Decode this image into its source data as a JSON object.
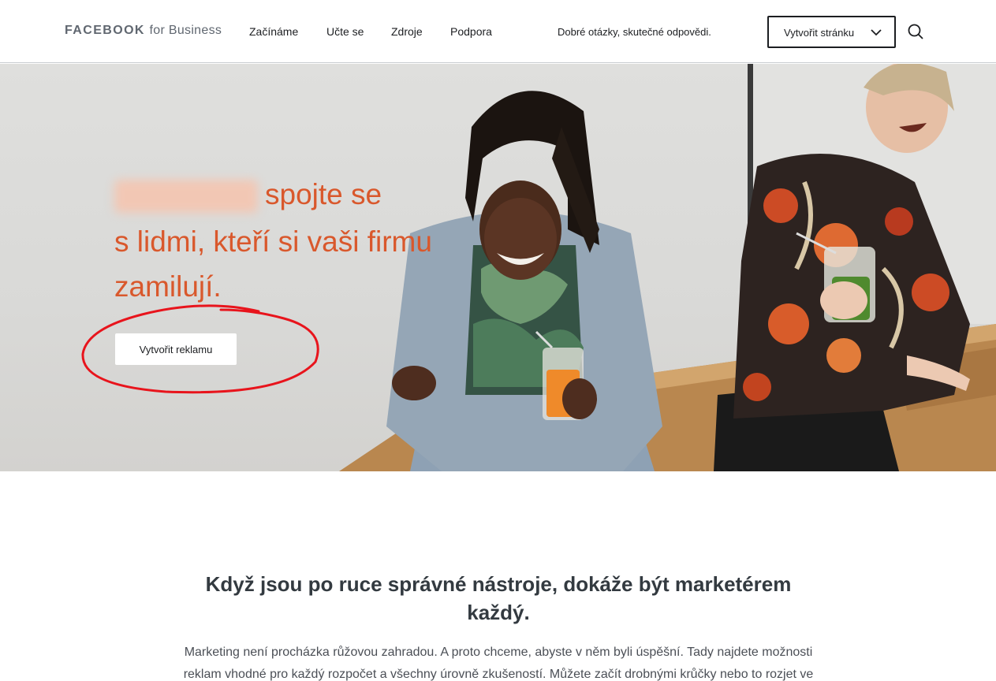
{
  "header": {
    "logo_brand": "FACEBOOK",
    "logo_suffix": "for Business",
    "nav": [
      "Začínáme",
      "Učte se",
      "Zdroje",
      "Podpora"
    ],
    "tagline": "Dobré otázky, skutečné odpovědi.",
    "create_page_label": "Vytvořit stránku"
  },
  "hero": {
    "line1": "spojte se",
    "line2": "s lidmi, kteří si vaši firmu",
    "line3": "zamilují.",
    "cta_label": "Vytvořit reklamu",
    "text_color": "#d9582c",
    "annotation_color": "#e8141c"
  },
  "content": {
    "headline": "Když jsou po ruce správné nástroje, dokáže být marketérem každý.",
    "body": "Marketing není procházka růžovou zahradou. A proto chceme, abyste v něm byli úspěšní. Tady najdete možnosti reklam vhodné pro každý rozpočet a všechny úrovně zkušeností. Můžete začít drobnými krůčky nebo to rozjet ve"
  },
  "icons": [
    "chevron-down-icon",
    "search-icon"
  ]
}
